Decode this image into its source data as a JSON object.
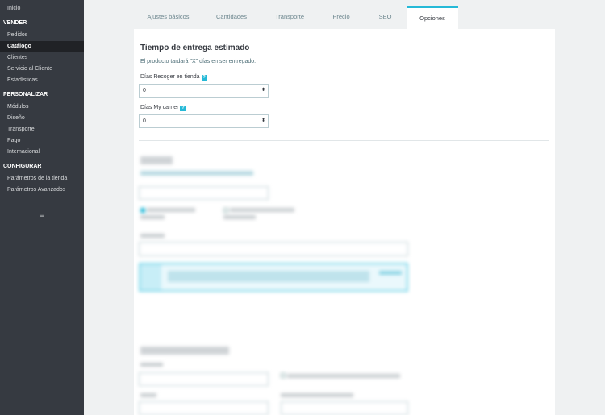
{
  "sidebar": {
    "home": "Inicio",
    "sections": [
      {
        "title": "VENDER",
        "items": [
          "Pedidos",
          "Catálogo",
          "Clientes",
          "Servicio al Cliente",
          "Estadísticas"
        ]
      },
      {
        "title": "PERSONALIZAR",
        "items": [
          "Módulos",
          "Diseño",
          "Transporte",
          "Pago",
          "Internacional"
        ]
      },
      {
        "title": "CONFIGURAR",
        "items": [
          "Parámetros de la tienda",
          "Parámetros Avanzados"
        ]
      }
    ],
    "active_item": "Catálogo",
    "toggle_icon": "≡"
  },
  "tabs": [
    {
      "label": "Ajustes básicos",
      "active": false
    },
    {
      "label": "Cantidades",
      "active": false
    },
    {
      "label": "Transporte",
      "active": false
    },
    {
      "label": "Precio",
      "active": false
    },
    {
      "label": "SEO",
      "active": false
    },
    {
      "label": "Opciones",
      "active": true
    }
  ],
  "delivery": {
    "title": "Tiempo de entrega estimado",
    "description": "El producto tardará \"X\" días en ser entregado.",
    "fields": [
      {
        "label": "Días Recoger en tienda",
        "help_icon": "?",
        "value": "0"
      },
      {
        "label": "Días My carrier",
        "help_icon": "?",
        "value": "0"
      }
    ]
  },
  "colors": {
    "sidebar_bg": "#363a41",
    "accent": "#25b9d7",
    "page_bg": "#eff1f2"
  }
}
